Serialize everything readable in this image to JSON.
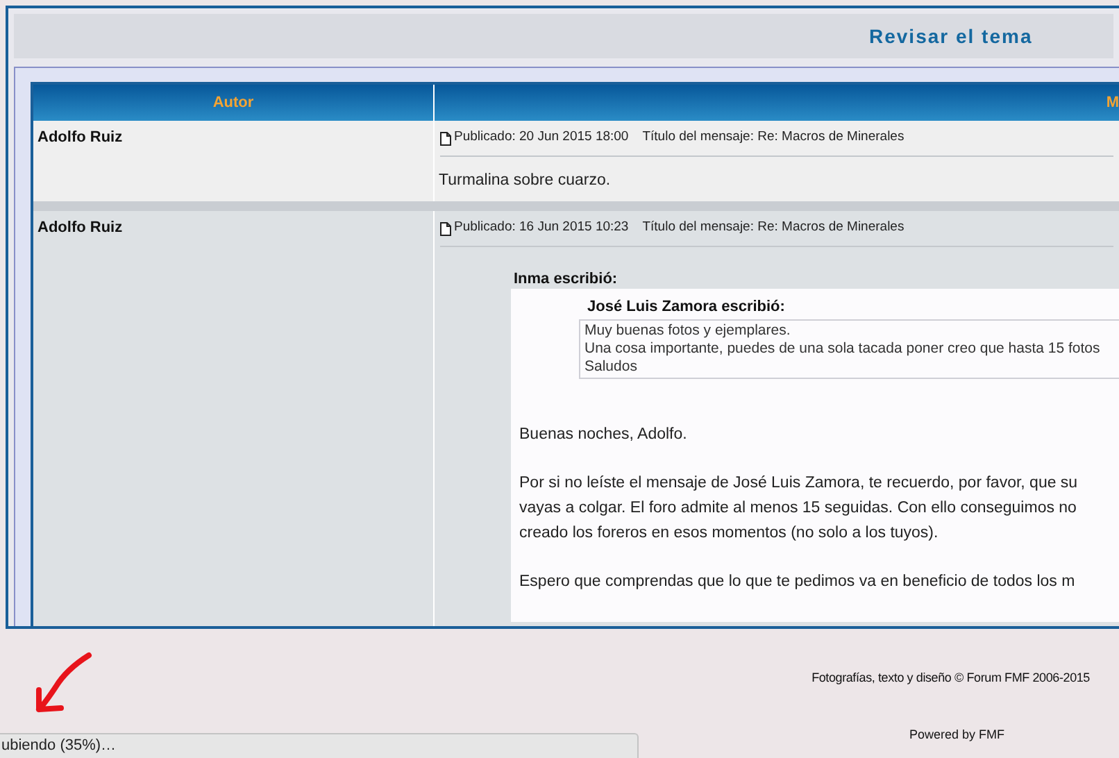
{
  "header": {
    "title": "Revisar el tema"
  },
  "table": {
    "columns": [
      "Autor",
      "M"
    ],
    "posts": [
      {
        "author": "Adolfo Ruiz",
        "posted": "Publicado: 20 Jun 2015 18:00",
        "subject": "Título del mensaje: Re: Macros de Minerales",
        "body": [
          {
            "kind": "text",
            "lines": [
              "Turmalina sobre cuarzo."
            ]
          }
        ]
      },
      {
        "author": "Adolfo Ruiz",
        "posted": "Publicado: 16 Jun 2015 10:23",
        "subject": "Título del mensaje: Re: Macros de Minerales",
        "body": [
          {
            "kind": "quote",
            "author": "Inma escribió:",
            "content": [
              {
                "kind": "quote",
                "author": "José Luis Zamora escribió:",
                "lines": [
                  "Muy buenas fotos y ejemplares.",
                  "Una cosa importante, puedes de una sola tacada poner creo que hasta 15 fotos",
                  "Saludos"
                ]
              },
              {
                "kind": "text",
                "lines": [
                  "Buenas noches, Adolfo."
                ]
              },
              {
                "kind": "text",
                "lines": [
                  "Por si no leíste el mensaje de José Luis Zamora, te recuerdo, por favor, que su",
                  "vayas a colgar. El foro admite al menos 15 seguidas. Con ello conseguimos no",
                  "creado los foreros en esos momentos (no solo a los tuyos)."
                ]
              },
              {
                "kind": "text",
                "lines": [
                  "Espero que comprendas que lo que te pedimos va en beneficio de todos los m"
                ]
              }
            ]
          }
        ]
      }
    ]
  },
  "footer": {
    "credits": "Fotografías, texto y diseño © Forum FMF 2006-2015",
    "powered": "Powered by FMF"
  },
  "status_bar": {
    "text": "ubiendo (35%)…"
  }
}
